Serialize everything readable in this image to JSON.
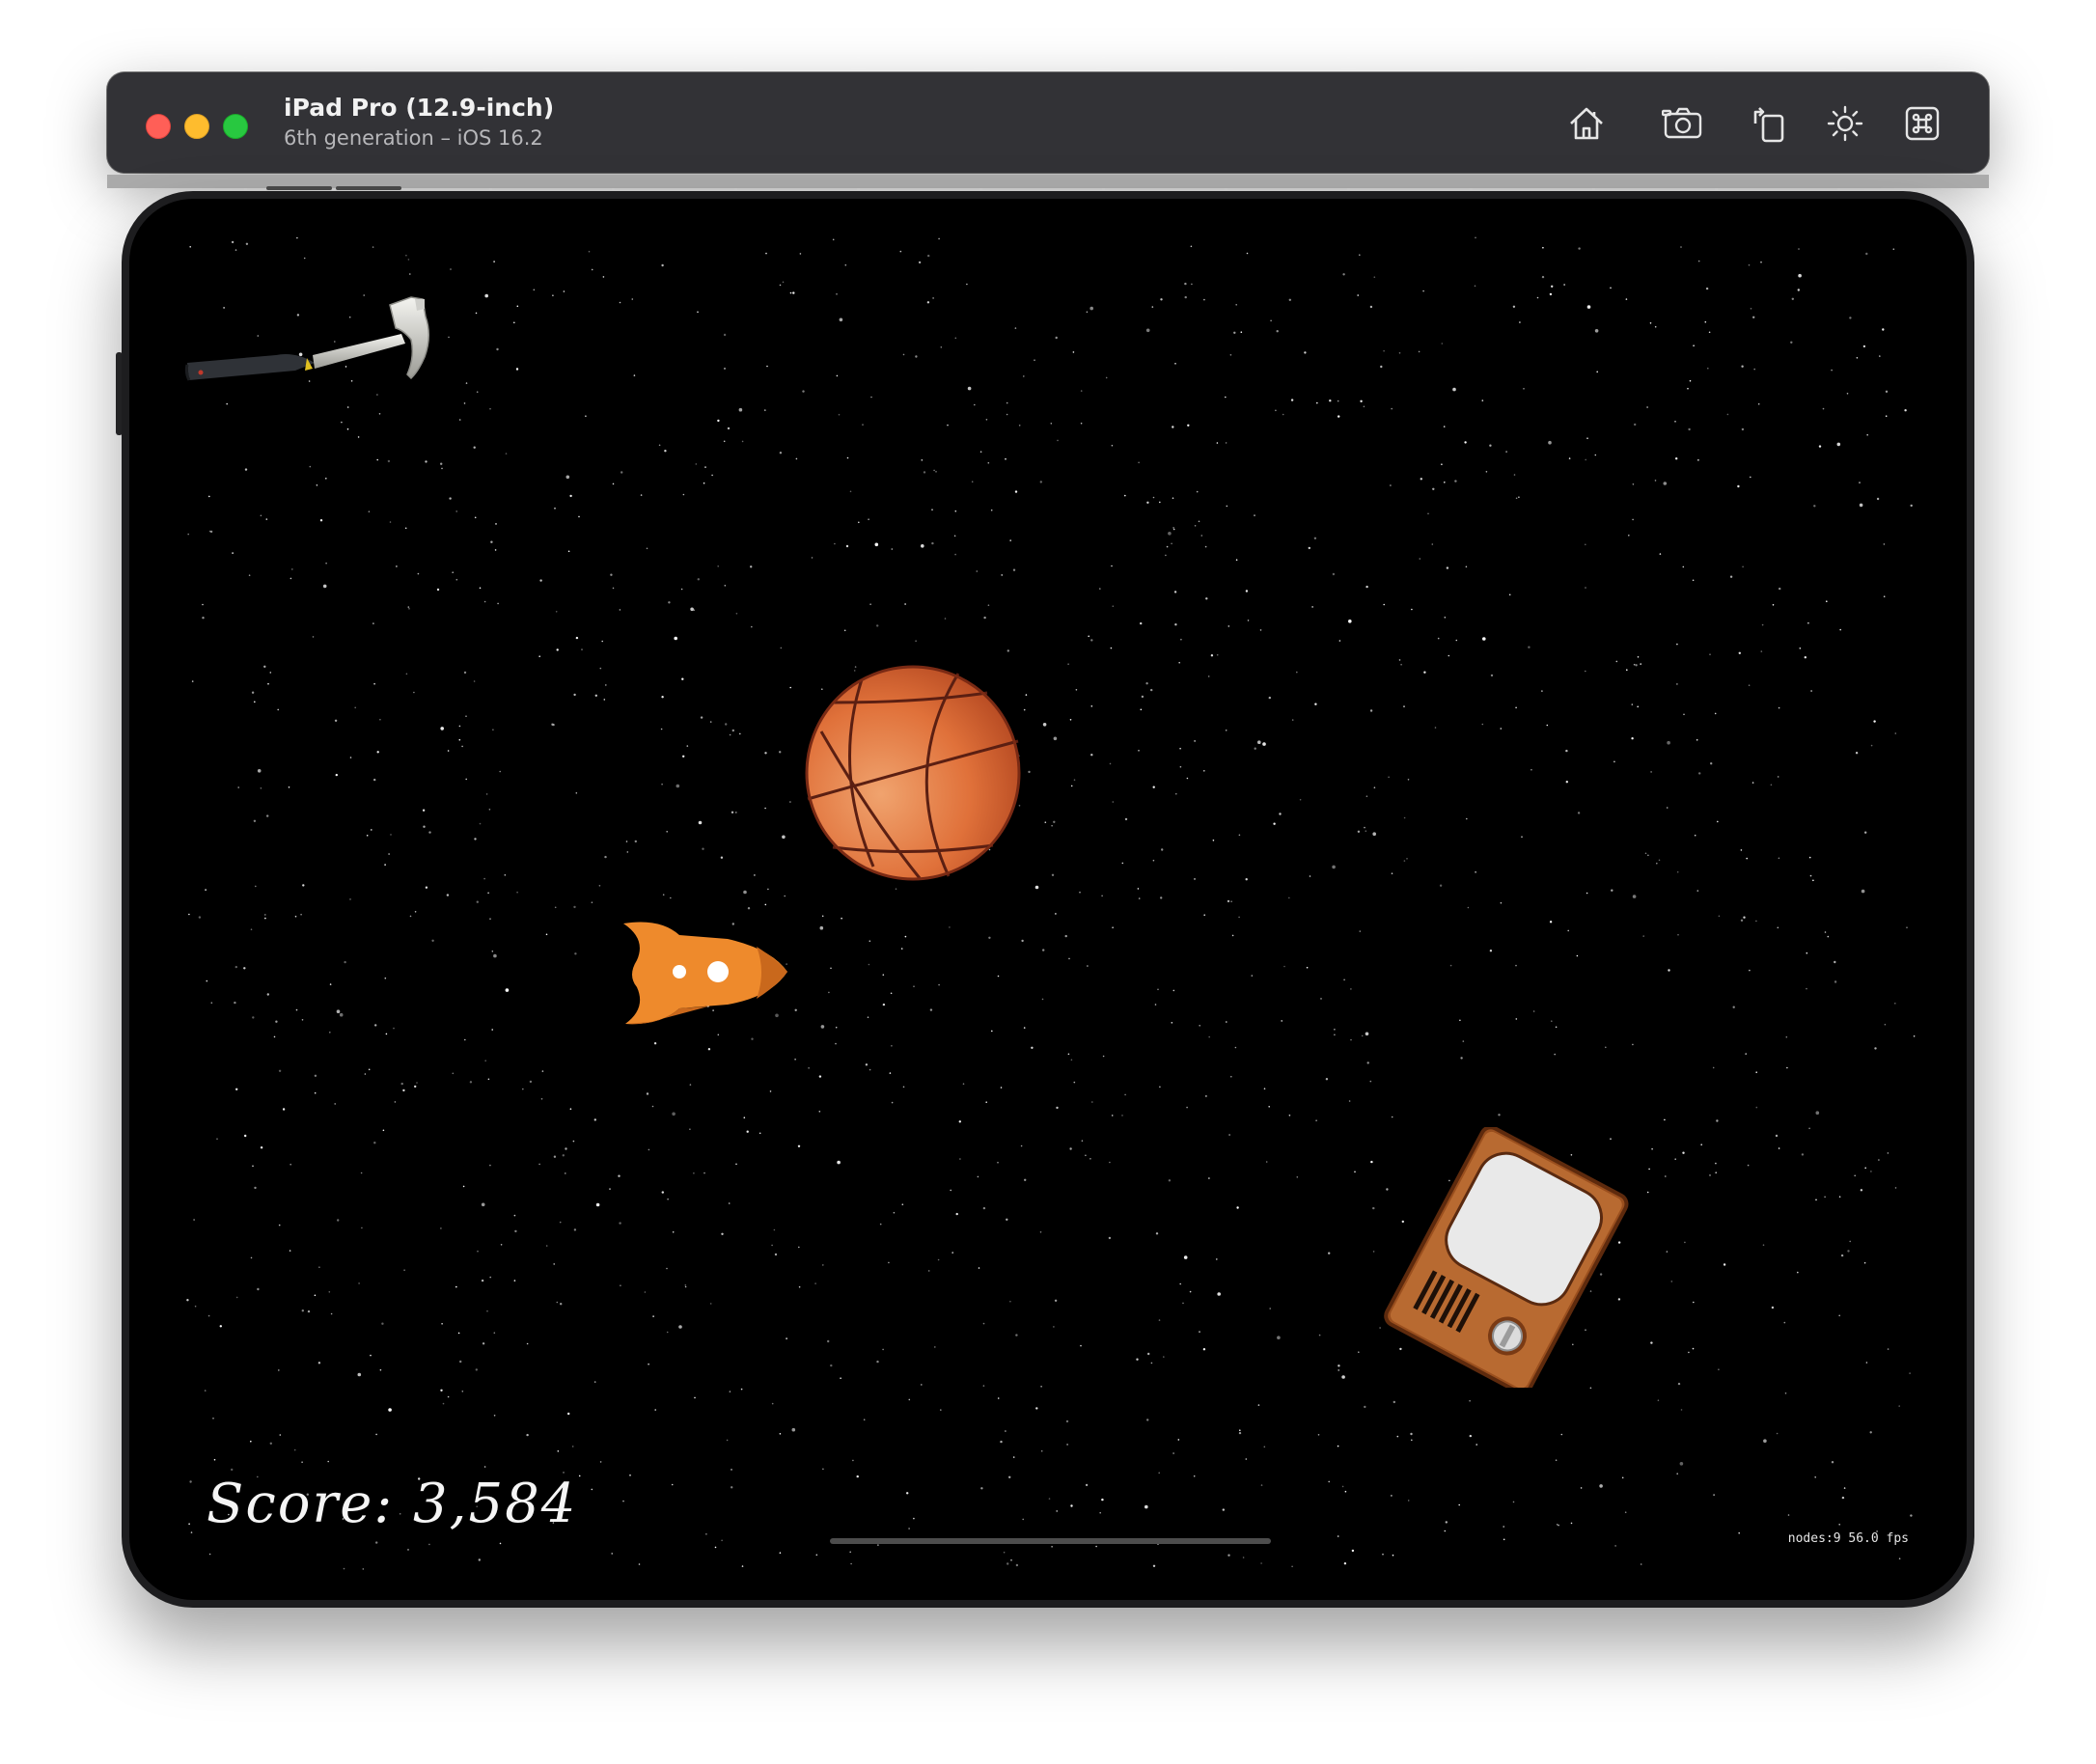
{
  "window": {
    "device_name": "iPad Pro (12.9-inch)",
    "device_subtitle": "6th generation – iOS 16.2",
    "traffic_lights": {
      "close": "#ff5f57",
      "minimize": "#febc2e",
      "maximize": "#28c840"
    },
    "toolbar": [
      {
        "name": "home",
        "icon": "home-icon"
      },
      {
        "name": "screenshot",
        "icon": "camera-icon"
      },
      {
        "name": "rotate",
        "icon": "rotate-icon"
      },
      {
        "name": "appearance",
        "icon": "brightness-icon"
      },
      {
        "name": "keyboard-shortcuts",
        "icon": "command-icon"
      }
    ]
  },
  "game": {
    "background": "#000000",
    "sprites": [
      "hammer",
      "basketball",
      "rocket",
      "television"
    ],
    "score_text": "Score: 3,584",
    "stats_text": "nodes:9  56.0 fps"
  }
}
